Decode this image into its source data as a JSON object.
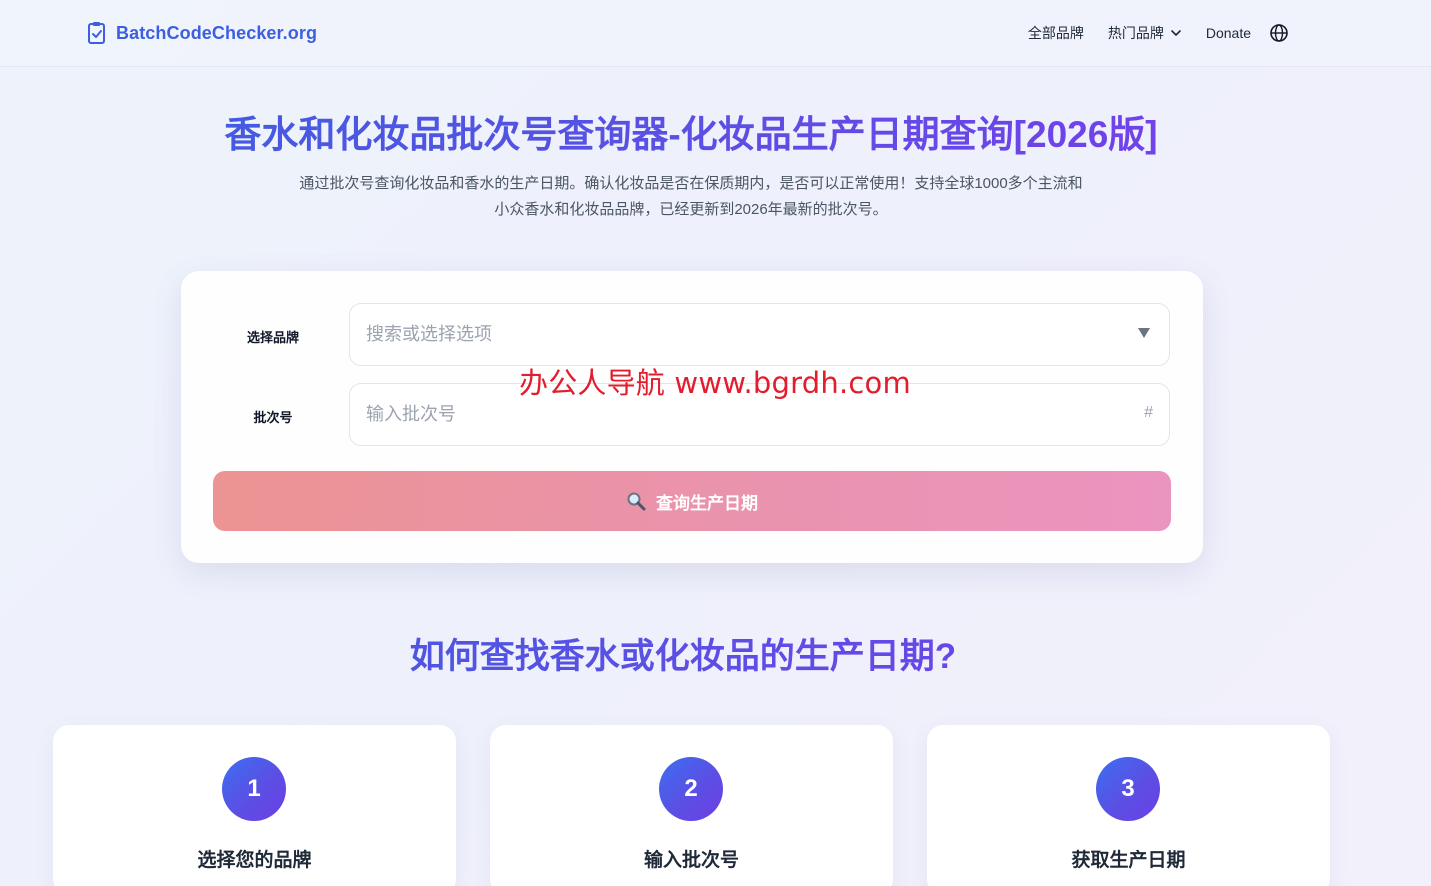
{
  "header": {
    "logo_text": "BatchCodeChecker.org",
    "logo_icon": "clipboard-check-icon",
    "nav": {
      "all_brands": "全部品牌",
      "popular_brands": "热门品牌",
      "donate": "Donate"
    },
    "language_icon": "globe-icon"
  },
  "hero": {
    "title": "香水和化妆品批次号查询器-化妆品生产日期查询[2026版]",
    "description": "通过批次号查询化妆品和香水的生产日期。确认化妆品是否在保质期内，是否可以正常使用！支持全球1000多个主流和小众香水和化妆品品牌，已经更新到2026年最新的批次号。"
  },
  "form": {
    "brand_label": "选择品牌",
    "brand_placeholder": "搜索或选择选项",
    "batch_label": "批次号",
    "batch_placeholder": "输入批次号",
    "batch_suffix": "#",
    "submit_label": "查询生产日期",
    "watermark": "办公人导航 www.bgrdh.com"
  },
  "how_to": {
    "title": "如何查找香水或化妆品的生产日期?",
    "steps": [
      {
        "number": "1",
        "title": "选择您的品牌"
      },
      {
        "number": "2",
        "title": "输入批次号"
      },
      {
        "number": "3",
        "title": "获取生产日期"
      }
    ]
  },
  "colors": {
    "brand_blue": "#3b5fe0",
    "accent_purple": "#7c3aed",
    "button_start": "#ec9393",
    "button_end": "#ea94c0",
    "watermark_red": "#e11d2e"
  }
}
